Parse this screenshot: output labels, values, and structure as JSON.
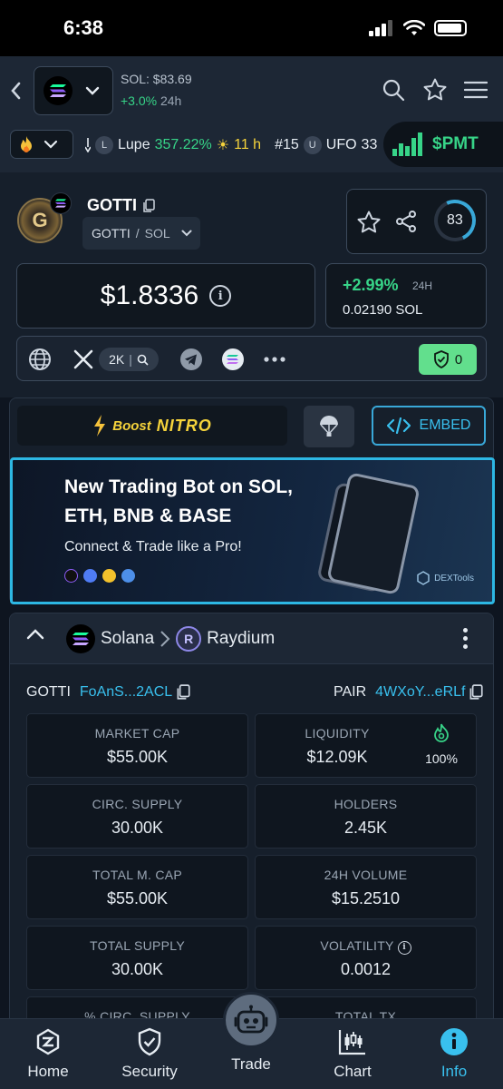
{
  "status_bar": {
    "time": "6:38"
  },
  "header": {
    "chain_price": "SOL: $83.69",
    "chain_change": "+3.0%",
    "chain_change_period": "24h"
  },
  "ticker": {
    "items": [
      {
        "badge": "L",
        "name": "Lupe",
        "change": "357.22%",
        "time": "11 h"
      },
      {
        "rank": "#15",
        "badge": "U",
        "name": "UFO",
        "value": "33"
      }
    ],
    "promo": "$PMT"
  },
  "token": {
    "symbol": "GOTTI",
    "pair_base": "GOTTI",
    "pair_quote": "SOL",
    "avatar_letter": "G",
    "score": "83",
    "price": "$1.8336",
    "change_pct": "+2.99%",
    "change_period": "24H",
    "price_in_sol": "0.02190 SOL",
    "x_followers": "2K",
    "security_count": "0"
  },
  "boost": {
    "boost_label": "Boost",
    "nitro_label": "NITRO",
    "embed_label": "EMBED"
  },
  "banner": {
    "line1": "New Trading Bot on SOL,",
    "line2": "ETH, BNB & BASE",
    "line3": "Connect & Trade like a Pro!",
    "brand": "DEXTools"
  },
  "pair_panel": {
    "chain": "Solana",
    "dex": "Raydium",
    "token_label": "GOTTI",
    "token_address": "FoAnS...2ACL",
    "pair_label": "PAIR",
    "pair_address": "4WXoY...eRLf",
    "liquidity_pct": "100%",
    "stats": [
      {
        "label": "MARKET CAP",
        "value": "$55.00K"
      },
      {
        "label": "LIQUIDITY",
        "value": "$12.09K"
      },
      {
        "label": "CIRC. SUPPLY",
        "value": "30.00K"
      },
      {
        "label": "HOLDERS",
        "value": "2.45K"
      },
      {
        "label": "TOTAL M. CAP",
        "value": "$55.00K"
      },
      {
        "label": "24H VOLUME",
        "value": "$15.2510"
      },
      {
        "label": "TOTAL SUPPLY",
        "value": "30.00K"
      },
      {
        "label": "VOLATILITY",
        "value": "0.0012"
      },
      {
        "label": "% CIRC. SUPPLY",
        "value": ""
      },
      {
        "label": "TOTAL TX",
        "value": ""
      }
    ]
  },
  "nav": {
    "home": "Home",
    "security": "Security",
    "trade": "Trade",
    "chart": "Chart",
    "info": "Info"
  },
  "colors": {
    "accent": "#39c0ee",
    "positive": "#37d488",
    "highlight": "#f5d33b",
    "background": "#0e1520"
  }
}
